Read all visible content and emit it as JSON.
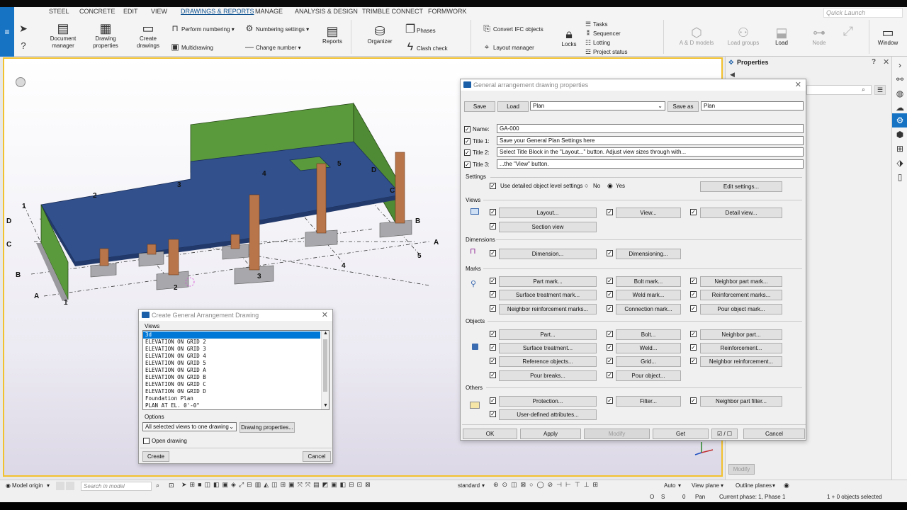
{
  "ribbon": {
    "tabs": [
      "STEEL",
      "CONCRETE",
      "EDIT",
      "VIEW",
      "DRAWINGS & REPORTS",
      "MANAGE",
      "ANALYSIS & DESIGN",
      "TRIMBLE CONNECT",
      "FORMWORK"
    ],
    "active_tab": "DRAWINGS & REPORTS",
    "quick_launch_placeholder": "Quick Launch",
    "buttons": {
      "document_manager": [
        "Document",
        "manager"
      ],
      "drawing_properties": [
        "Drawing",
        "properties"
      ],
      "create_drawings": [
        "Create",
        "drawings"
      ],
      "perform_numbering": "Perform numbering",
      "numbering_settings": "Numbering settings",
      "multidrawing": "Multidrawing",
      "change_number": "Change number",
      "reports": "Reports",
      "organizer": "Organizer",
      "phases": "Phases",
      "clash_check": "Clash check",
      "convert_ifc": "Convert IFC objects",
      "layout_manager": "Layout manager",
      "locks": "Locks",
      "tasks": "Tasks",
      "sequencer": "Sequencer",
      "lotting": "Lotting",
      "project_status": "Project status",
      "ad_models": "A & D models",
      "load_groups": "Load groups",
      "load": "Load",
      "node": "Node",
      "window": "Window"
    }
  },
  "model": {
    "grid_labels": {
      "numbers_top": [
        "1",
        "2",
        "3",
        "4",
        "5"
      ],
      "letters_left": [
        "D",
        "C",
        "B",
        "A"
      ],
      "letters_right": [
        "B",
        "A"
      ],
      "numbers_bottom": [
        "1",
        "2",
        "3",
        "4",
        "5"
      ],
      "letters_back": [
        "D",
        "C"
      ]
    }
  },
  "properties_panel": {
    "title": "Properties"
  },
  "ga_dialog": {
    "title": "General arrangement drawing properties",
    "save": "Save",
    "load": "Load",
    "settings_select": "Plan",
    "save_as": "Save as",
    "save_as_value": "Plan",
    "name_label": "Name:",
    "name_value": "GA-000",
    "title1_label": "Title 1:",
    "title1_value": "Save your General Plan Settings here",
    "title2_label": "Title 2:",
    "title2_value": "Select Title Block in the \"Layout...\" button.  Adjust view sizes through with...",
    "title3_label": "Title 3:",
    "title3_value": "...the \"View\" button.",
    "settings_section": "Settings",
    "use_detailed": "Use detailed object level settings",
    "no": "No",
    "yes": "Yes",
    "edit_settings": "Edit settings...",
    "views_section": "Views",
    "layout": "Layout...",
    "view": "View...",
    "detail_view": "Detail view...",
    "section_view": "Section view",
    "dimensions_section": "Dimensions",
    "dimension": "Dimension...",
    "dimensioning": "Dimensioning...",
    "marks_section": "Marks",
    "part_mark": "Part mark...",
    "bolt_mark": "Bolt mark...",
    "neighbor_part_mark": "Neighbor part mark...",
    "surface_treatment_mark": "Surface treatment mark...",
    "weld_mark": "Weld mark...",
    "reinforcement_marks": "Reinforcement marks...",
    "neighbor_reinforcement_marks": "Neighbor reinforcement marks...",
    "connection_mark": "Connection mark...",
    "pour_object_mark": "Pour object mark...",
    "objects_section": "Objects",
    "part": "Part...",
    "bolt": "Bolt...",
    "neighbor_part": "Neighbor part...",
    "surface_treatment": "Surface treatment...",
    "weld": "Weld...",
    "reinforcement": "Reinforcement...",
    "reference_objects": "Reference objects...",
    "grid": "Grid...",
    "neighbor_reinforcement": "Neighbor reinforcement...",
    "pour_breaks": "Pour breaks...",
    "pour_object": "Pour object...",
    "others_section": "Others",
    "protection": "Protection...",
    "filter": "Filter...",
    "neighbor_part_filter": "Neighbor part filter...",
    "user_defined_attributes": "User-defined attributes...",
    "ok": "OK",
    "apply": "Apply",
    "modify": "Modify",
    "get": "Get",
    "cancel": "Cancel"
  },
  "create_dialog": {
    "title": "Create General Arrangement Drawing",
    "views_label": "Views",
    "views": [
      "3d",
      "ELEVATION ON GRID 2",
      "ELEVATION ON GRID 3",
      "ELEVATION ON GRID 4",
      "ELEVATION ON GRID 5",
      "ELEVATION ON GRID A",
      "ELEVATION ON GRID B",
      "ELEVATION ON GRID C",
      "ELEVATION ON GRID D",
      "Foundation Plan",
      "PLAN AT EL. 0'-0\""
    ],
    "selected_view": "3d",
    "options_label": "Options",
    "options_select": "All selected views to one drawing",
    "drawing_properties": "Drawing properties...",
    "open_drawing": "Open drawing",
    "create": "Create",
    "cancel": "Cancel"
  },
  "statusbar": {
    "model_origin": "Model origin",
    "search_placeholder": "Search in model",
    "standard": "standard",
    "auto": "Auto",
    "view_plane": "View plane",
    "outline_planes": "Outline planes",
    "o": "O",
    "s": "S",
    "zero": "0",
    "pan": "Pan",
    "current_phase": "Current phase: 1, Phase 1",
    "selected": "1 + 0 objects selected",
    "modify": "Modify"
  },
  "colors": {
    "accent": "#1673c4",
    "slab": "#31508c",
    "wall": "#5a9a3c",
    "column": "#b8754a",
    "footing": "#a8a8ac",
    "viewport_border": "#f2c12e"
  }
}
